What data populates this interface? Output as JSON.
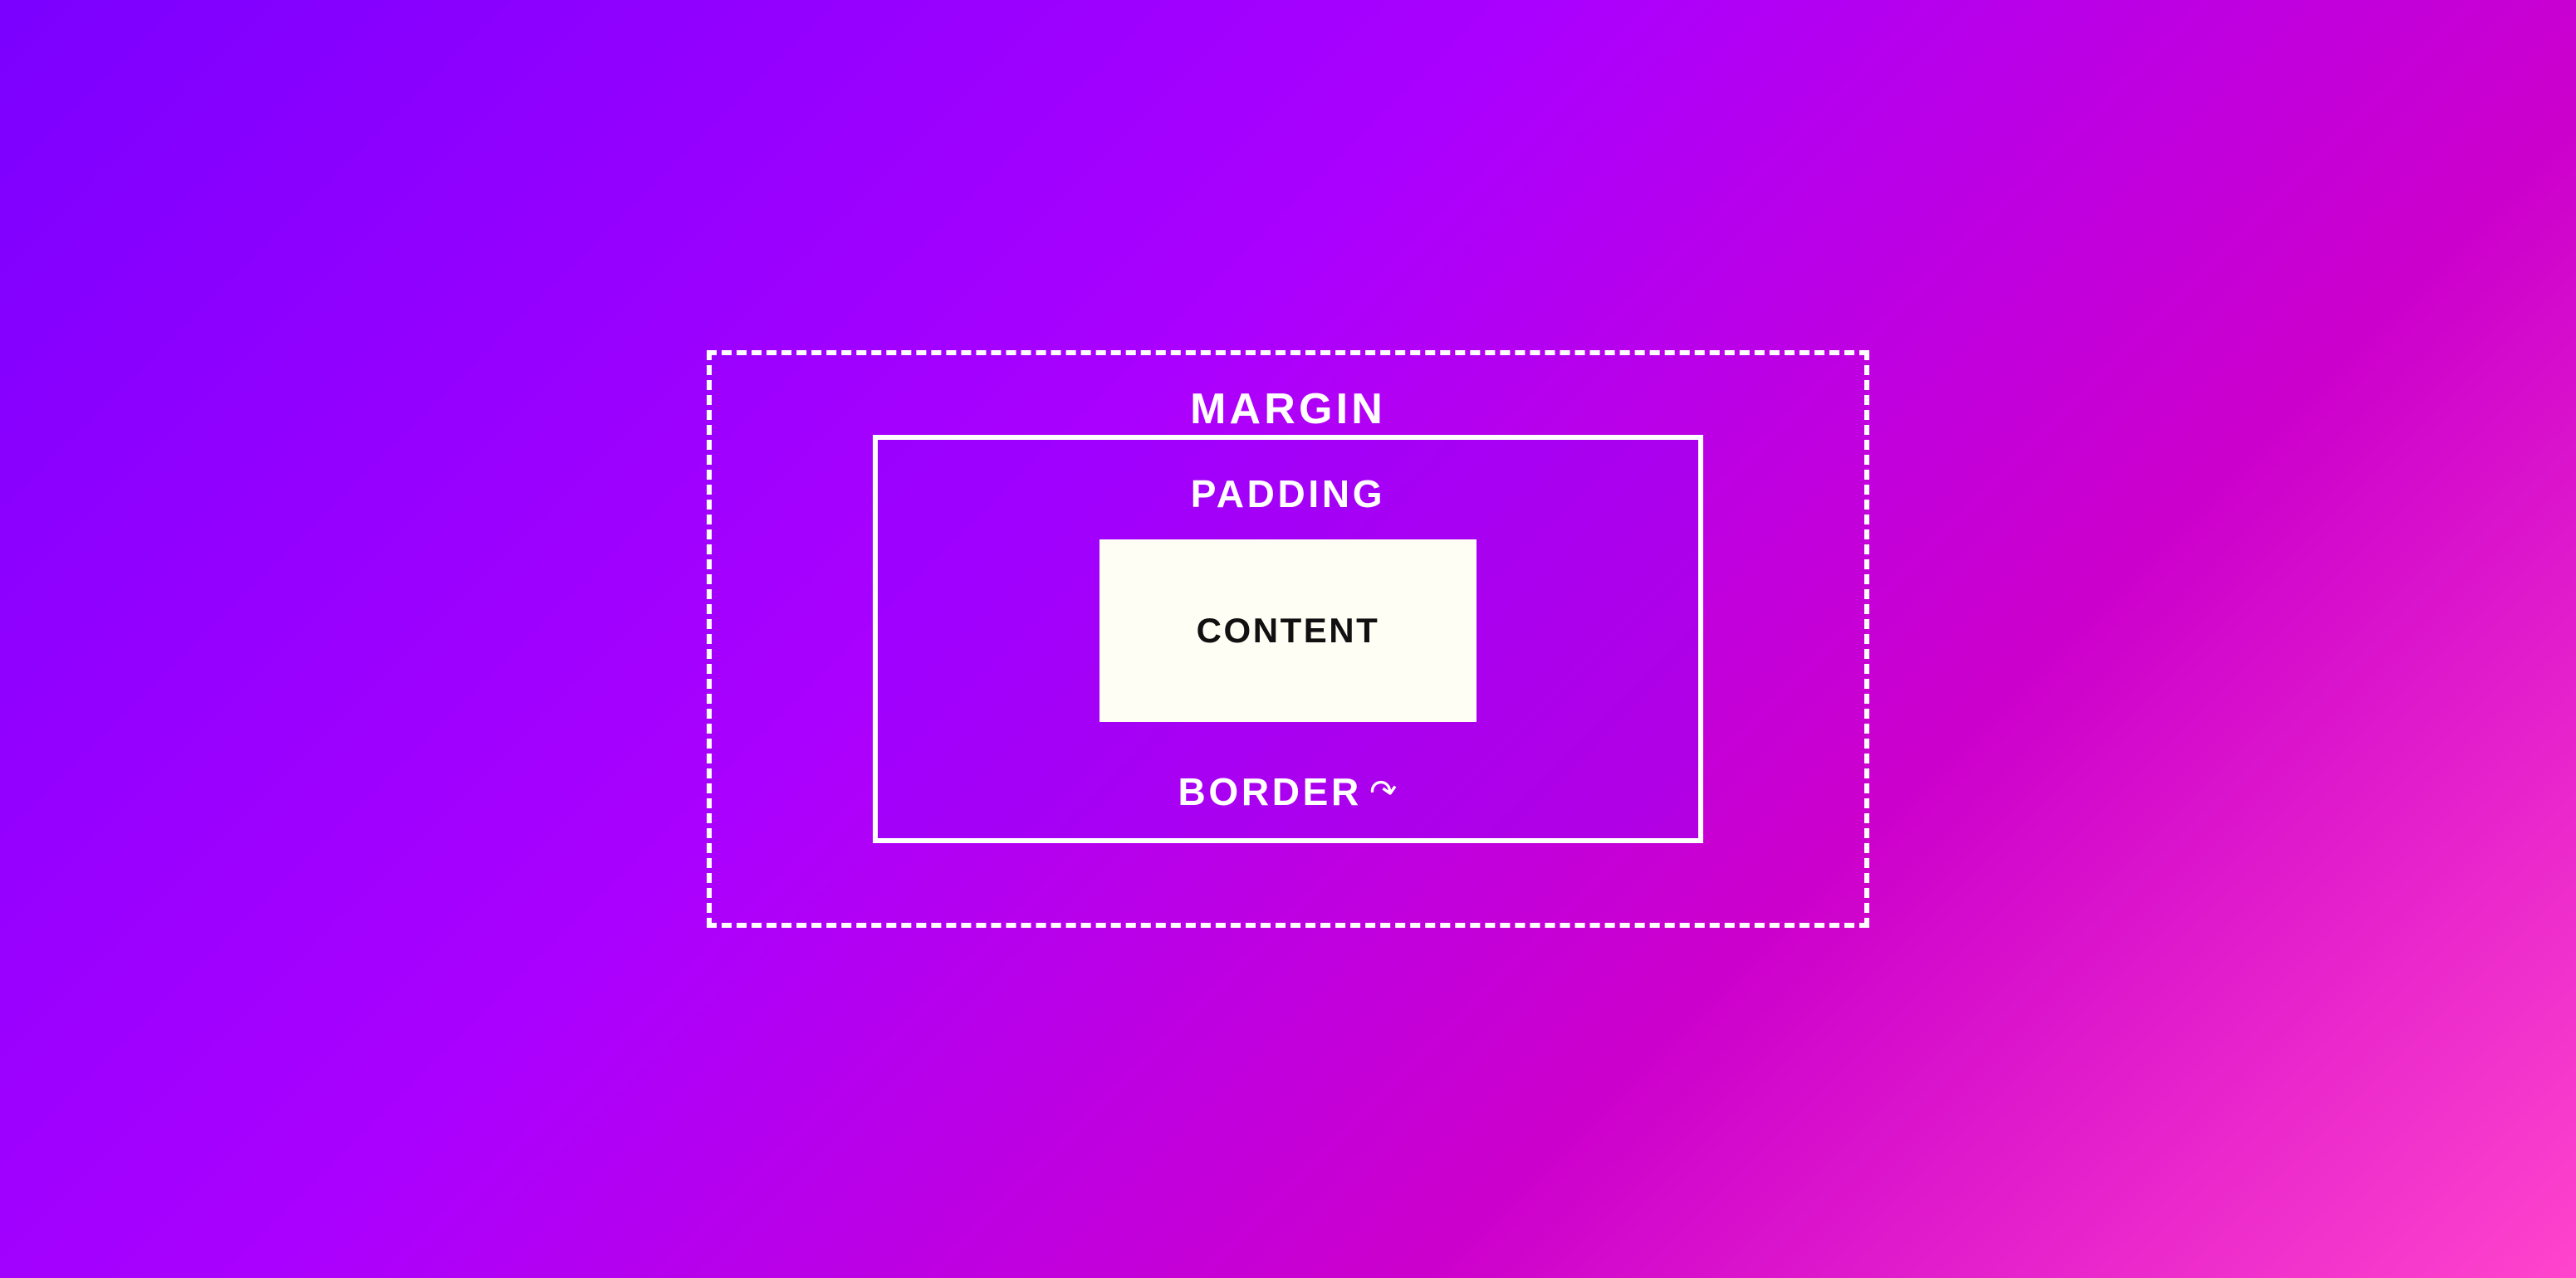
{
  "diagram": {
    "background_gradient_start": "#7B00FF",
    "background_gradient_end": "#FF44CC",
    "margin_label": "MARGIN",
    "padding_label": "PADDING",
    "content_label": "CONTENT",
    "border_label": "BORDER",
    "arrow_symbol": "↗",
    "arrow_description": "cursor arrow icon pointing to border"
  }
}
